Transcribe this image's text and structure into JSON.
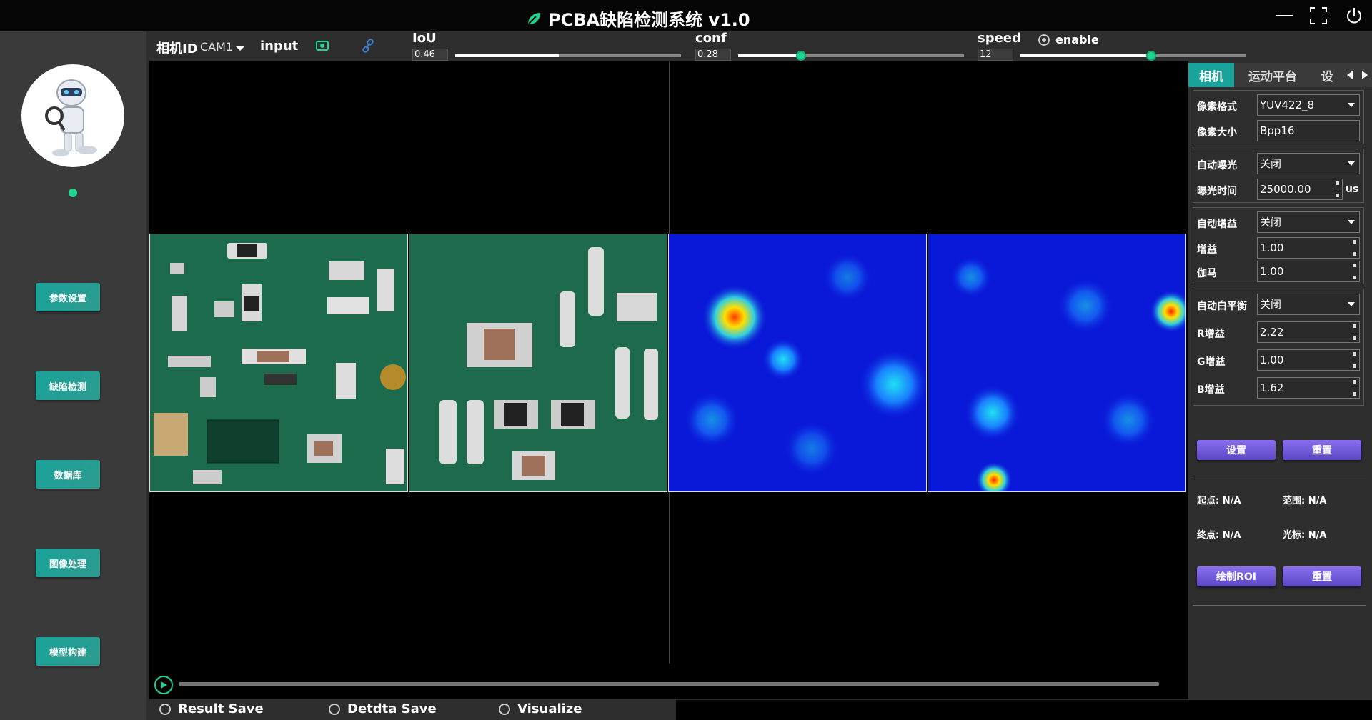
{
  "app": {
    "title": "PCBA缺陷检测系统 v1.0"
  },
  "window_controls": {
    "minimize_icon": "minimize-icon",
    "fullscreen_icon": "fullscreen-icon",
    "power_icon": "power-icon"
  },
  "sidebar": {
    "items": [
      {
        "label": "参数设置"
      },
      {
        "label": "缺陷检测"
      },
      {
        "label": "数据库"
      },
      {
        "label": "图像处理"
      },
      {
        "label": "模型构建"
      }
    ]
  },
  "topbar": {
    "camera_label": "相机ID",
    "camera_value": "CAM1",
    "input_label": "input",
    "iou": {
      "label": "IoU",
      "value": "0.46",
      "level": 0.46
    },
    "conf": {
      "label": "conf",
      "value": "0.28",
      "level": 0.28
    },
    "speed": {
      "label": "speed",
      "value": "12",
      "level": 0.58
    },
    "enable_label": "enable"
  },
  "bottombar": {
    "result_save": "Result Save",
    "detdta_save": "Detdta Save",
    "visualize": "Visualize"
  },
  "rightpanel": {
    "tabs": [
      "相机",
      "运动平台",
      "设"
    ],
    "group1": {
      "pixel_format_label": "像素格式",
      "pixel_format_value": "YUV422_8",
      "pixel_size_label": "像素大小",
      "pixel_size_value": "Bpp16"
    },
    "group2": {
      "auto_exposure_label": "自动曝光",
      "auto_exposure_value": "关闭",
      "exposure_time_label": "曝光时间",
      "exposure_time_value": "25000.00",
      "exposure_unit": "us"
    },
    "group3": {
      "auto_gain_label": "自动增益",
      "auto_gain_value": "关闭",
      "gain_label": "增益",
      "gain_value": "1.00",
      "gamma_label": "伽马",
      "gamma_value": "1.00"
    },
    "group4": {
      "auto_wb_label": "自动白平衡",
      "auto_wb_value": "关闭",
      "r_gain_label": "R增益",
      "r_gain_value": "2.22",
      "g_gain_label": "G增益",
      "g_gain_value": "1.00",
      "b_gain_label": "B增益",
      "b_gain_value": "1.62"
    },
    "set_button": "设置",
    "reset_button": "重置",
    "start_point": "起点: N/A",
    "range": "范围: N/A",
    "end_point": "终点: N/A",
    "cursor": "光标: N/A",
    "draw_roi_button": "绘制ROI",
    "reset_button2": "重置"
  },
  "colors": {
    "accent": "#1ed48e",
    "teal_button": "#1aa39a",
    "purple_button": "#6e57d6"
  }
}
